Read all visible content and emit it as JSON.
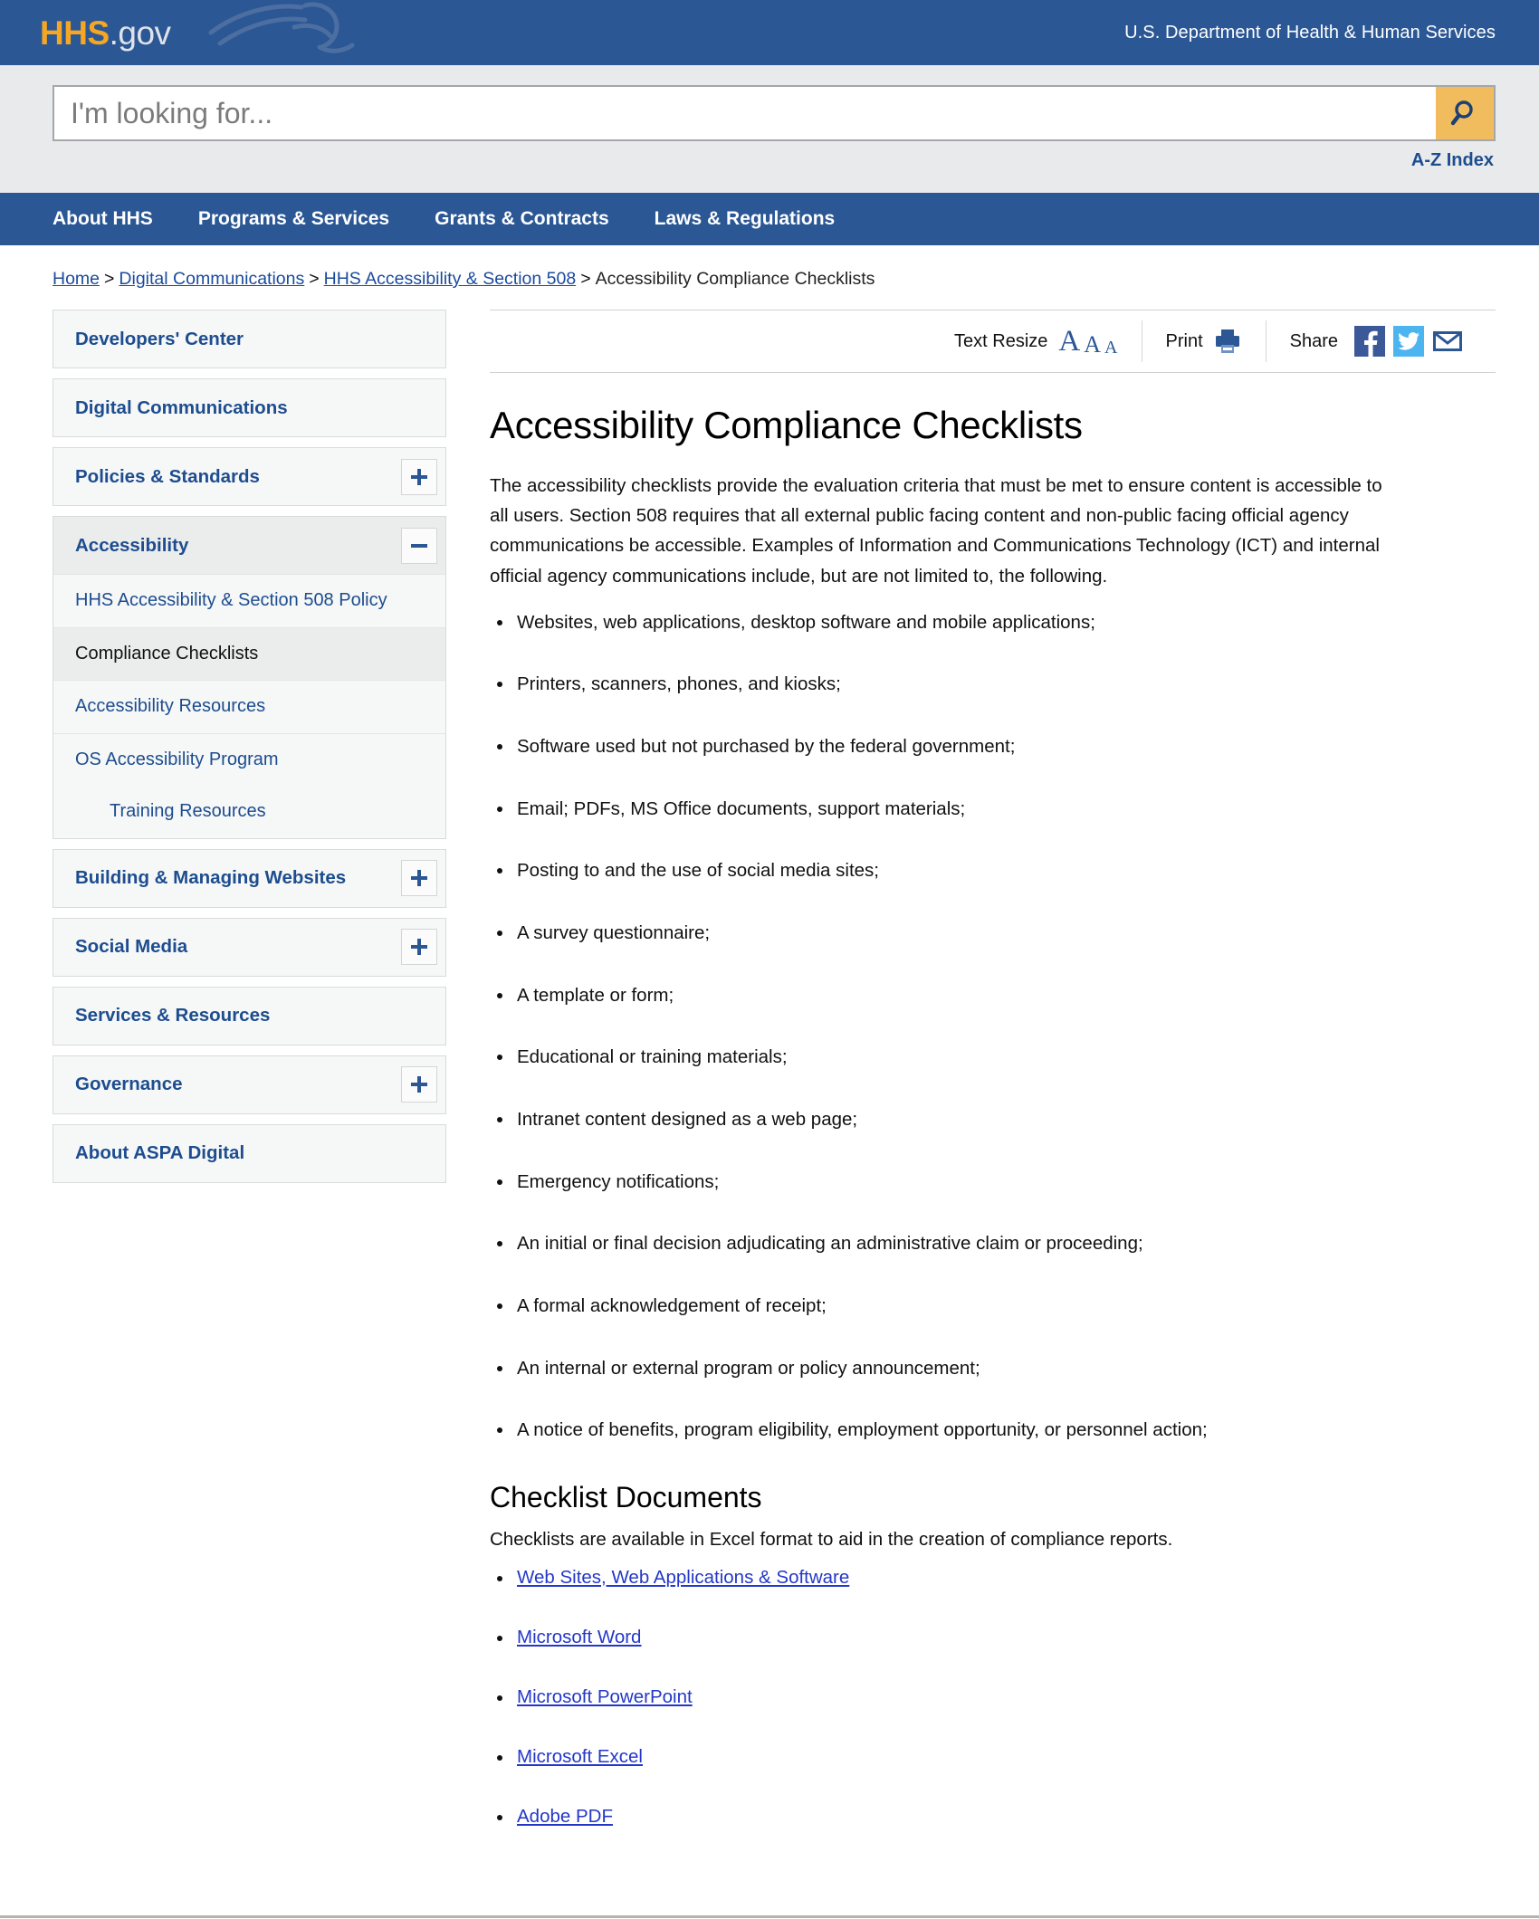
{
  "header": {
    "logo_hhs": "HHS",
    "logo_gov": ".gov",
    "department": "U.S. Department of Health & Human Services",
    "bird_icon": "hhs-bird-watermark-icon"
  },
  "search": {
    "placeholder": "I'm looking for...",
    "value": "",
    "button_icon": "search-magnifier-icon",
    "az_index": "A-Z Index"
  },
  "mainnav": {
    "items": [
      {
        "label": "About HHS"
      },
      {
        "label": "Programs & Services"
      },
      {
        "label": "Grants & Contracts"
      },
      {
        "label": "Laws & Regulations"
      }
    ]
  },
  "breadcrumb": {
    "sep": ">",
    "items": [
      {
        "label": "Home",
        "link": true
      },
      {
        "label": "Digital Communications",
        "link": true
      },
      {
        "label": "HHS Accessibility & Section 508",
        "link": true
      },
      {
        "label": "Accessibility Compliance Checklists",
        "link": false
      }
    ]
  },
  "sidebar": {
    "blocks": [
      {
        "label": "Developers' Center",
        "toggle": null,
        "active": false,
        "subs": []
      },
      {
        "label": "Digital Communications",
        "toggle": null,
        "active": false,
        "subs": []
      },
      {
        "label": "Policies & Standards",
        "toggle": "plus",
        "active": false,
        "subs": []
      },
      {
        "label": "Accessibility",
        "toggle": "minus",
        "active": true,
        "subs": [
          {
            "label": "HHS Accessibility & Section 508 Policy",
            "current": false,
            "indent": false
          },
          {
            "label": "Compliance Checklists",
            "current": true,
            "indent": false
          },
          {
            "label": "Accessibility Resources",
            "current": false,
            "indent": false
          },
          {
            "label": "OS Accessibility Program",
            "current": false,
            "indent": false
          },
          {
            "label": "Training Resources",
            "current": false,
            "indent": true
          }
        ]
      },
      {
        "label": "Building & Managing Websites",
        "toggle": "plus",
        "active": false,
        "subs": []
      },
      {
        "label": "Social Media",
        "toggle": "plus",
        "active": false,
        "subs": []
      },
      {
        "label": "Services & Resources",
        "toggle": null,
        "active": false,
        "subs": []
      },
      {
        "label": "Governance",
        "toggle": "plus",
        "active": false,
        "subs": []
      },
      {
        "label": "About ASPA Digital",
        "toggle": null,
        "active": false,
        "subs": []
      }
    ]
  },
  "toolbar": {
    "text_resize_label": "Text Resize",
    "resize_a_large": "A",
    "resize_a_medium": "A",
    "resize_a_small": "A",
    "print_label": "Print",
    "print_icon": "printer-icon",
    "share_label": "Share",
    "facebook_icon": "facebook-icon",
    "twitter_icon": "twitter-icon",
    "email_icon": "email-envelope-icon"
  },
  "main": {
    "title": "Accessibility Compliance Checklists",
    "intro": "The accessibility checklists provide the evaluation criteria that must be met to ensure content is accessible to all users. Section 508 requires that all external public facing content and non-public facing official agency communications be accessible. Examples of Information and Communications Technology (ICT) and internal official agency communications include, but are not limited to, the following.",
    "examples": [
      "Websites, web applications, desktop software and mobile applications;",
      "Printers, scanners, phones, and kiosks;",
      "Software used but not purchased by the federal government;",
      "Email; PDFs, MS Office documents, support materials;",
      "Posting to and the use of social media sites;",
      "A survey questionnaire;",
      "A template or form;",
      "Educational or training materials;",
      "Intranet content designed as a web page;",
      "Emergency notifications;",
      "An initial or final decision adjudicating an administrative claim or proceeding;",
      "A formal acknowledgement of receipt;",
      "An internal or external program or policy announcement;",
      "A notice of benefits, program eligibility, employment opportunity, or personnel action;"
    ],
    "docs_heading": "Checklist Documents",
    "docs_lead": "Checklists are available in Excel format to aid in the creation of compliance reports.",
    "docs": [
      "Web Sites, Web Applications & Software",
      "Microsoft Word",
      "Microsoft PowerPoint",
      "Microsoft Excel",
      "Adobe PDF"
    ]
  },
  "colors": {
    "header_blue": "#2b5795",
    "link_blue": "#1d4d8f",
    "doc_link_blue": "#2437c8",
    "logo_orange": "#f5a623",
    "search_button": "#f0bc5e",
    "facebook": "#3b5998",
    "twitter": "#4cb4ef",
    "sidebar_bg": "#f6f7f7",
    "active_bg": "#ebecec"
  }
}
